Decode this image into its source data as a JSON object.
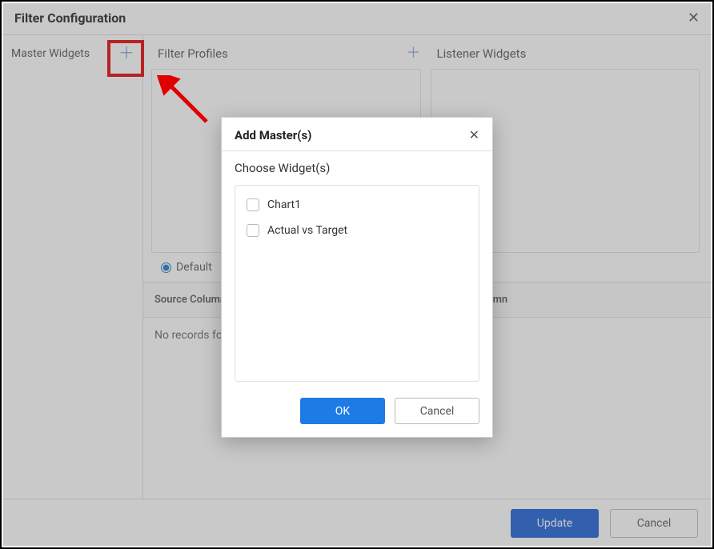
{
  "main_dialog": {
    "title": "Filter Configuration"
  },
  "sidebar": {
    "master_widgets_label": "Master Widgets"
  },
  "panels": {
    "filter_profiles_label": "Filter Profiles",
    "listener_widgets_label": "Listener Widgets",
    "default_radio_label": "Default"
  },
  "table": {
    "col_source_column": "Source Column",
    "col_target_column": "Target Column",
    "no_records": "No records found"
  },
  "footer": {
    "update_label": "Update",
    "cancel_label": "Cancel"
  },
  "inner_modal": {
    "title": "Add Master(s)",
    "choose_label": "Choose Widget(s)",
    "widgets": [
      {
        "label": "Chart1"
      },
      {
        "label": "Actual vs Target"
      }
    ],
    "ok_label": "OK",
    "cancel_label": "Cancel"
  },
  "annotation": {
    "highlight_target": "add-master-button"
  }
}
